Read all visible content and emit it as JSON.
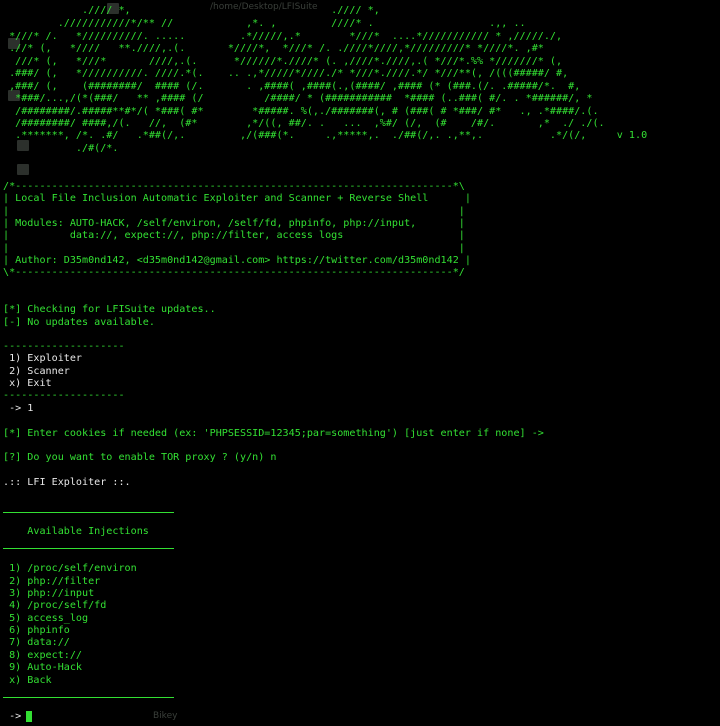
{
  "window": {
    "path_ghost": "/home/Desktop/LFISuite",
    "bottom_ghost": "Bikey"
  },
  "banner": [
    "             .//// *,                                 .//// *,",
    "         .///////////*/** //            ,*. ,         ////* .                   .,, ..",
    " *///* /.   *//////////. .....         .*/////,.*        *///*  ....*/////////// * ,/////./,",
    " .//* (,   *////   **.////,.(.       *////*,  *///* /. .////*////,*/////////* *////*. ,#*",
    "  ///* (,   *///*       ////,.(.      *//////*.////* (. ,////*.////,.( *///*.%% *///////* (,",
    " .###/ (,   *//////////. ////.*(.    .. .,*/////*////./* *///*.////.*/ *///**(, /(((#####/ #,",
    " ,###/ (,    (########/  #### (/.       . ,####( ,####(.,(####/ ,#### (* (###.(/. .#####/*.  #,",
    "  *###/...,/(*(###/   ** ,#### (/          /####/ * (###########  *#### (..###( #/. . *######/, *",
    "  /########/.#####**#*/( *###( #*        *#####. %(,./#######(, # (###( # *###/ #*   ., .*####/.(.",
    "  /########/ ####,/(.   //,  (#*        ,*/((, ##/. .   ...  ,%#/ (/,  (#    /#/.       ,*  ./ ./(.",
    "  .*******, /*. .#/   .*##(/,.         ,/(###(*.     .,*****,.  ./##(/,. .,**,.           .*/(/,     v 1.0",
    "            ./#(/*."
  ],
  "info_box": {
    "top": "/*------------------------------------------------------------------------*\\",
    "blank": "|                                                                          |",
    "title": "| Local File Inclusion Automatic Exploiter and Scanner + Reverse Shell      |",
    "modules1": "| Modules: AUTO-HACK, /self/environ, /self/fd, phpinfo, php://input,       |",
    "modules2": "|          data://, expect://, php://filter, access logs                   |",
    "author": "| Author: D35m0nd142, <d35m0nd142@gmail.com> https://twitter.com/d35m0nd142 |",
    "bottom": "\\*------------------------------------------------------------------------*/"
  },
  "status": {
    "checking": "[*] Checking for LFISuite updates..",
    "no_updates": "[-] No updates available."
  },
  "menu": {
    "separator": "--------------------",
    "items": [
      " 1) Exploiter",
      " 2) Scanner",
      " x) Exit"
    ],
    "choice": " -> 1"
  },
  "cookies_prompt": "[*] Enter cookies if needed (ex: 'PHPSESSID=12345;par=something') [just enter if none] ->",
  "tor_prompt": "[?] Do you want to enable TOR proxy ? (y/n) n",
  "exploiter_title": ".:: LFI Exploiter ::.",
  "injections": {
    "heading": "    Available Injections",
    "items": [
      " 1) /proc/self/environ",
      " 2) php://filter",
      " 3) php://input",
      " 4) /proc/self/fd",
      " 5) access_log",
      " 6) phpinfo",
      " 7) data://",
      " 8) expect://",
      " 9) Auto-Hack",
      " x) Back"
    ]
  },
  "prompt": " ->",
  "colors": {
    "terminal_green": "#33e033",
    "background": "#000000",
    "text_white": "#e8e8e8"
  }
}
